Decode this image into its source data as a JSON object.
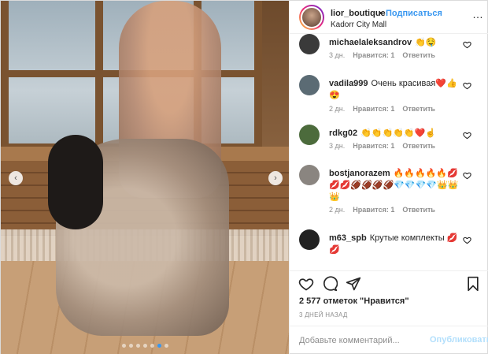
{
  "photo": {
    "slide_count": 7,
    "active_slide_index": 5,
    "nav_prev_glyph": "‹",
    "nav_next_glyph": "›"
  },
  "header": {
    "username": "lior_boutique",
    "separator": "•",
    "follow_label": "Подписаться",
    "location": "Kadorr City Mall",
    "more_glyph": "…"
  },
  "comments": [
    {
      "user": "michaelaleksandrov",
      "text": "👏🤤",
      "time": "3 дн.",
      "likes": "Нравится: 1",
      "reply": "Ответить",
      "avatar_color": "#3a3a3a"
    },
    {
      "user": "vadila999",
      "text": "Очень красивая❤️👍😍",
      "time": "2 дн.",
      "likes": "Нравится: 1",
      "reply": "Ответить",
      "avatar_color": "#5b6b74"
    },
    {
      "user": "rdkg02",
      "text": "👏👏👏👏👏❤️☝️",
      "time": "3 дн.",
      "likes": "Нравится: 1",
      "reply": "Ответить",
      "avatar_color": "#4c6b3c"
    },
    {
      "user": "bostjanorazem",
      "text": "🔥🔥🔥🔥🔥💋💋💋🏈🏈🏈🏈💎💎💎💎👑👑👑",
      "time": "2 дн.",
      "likes": "Нравится: 1",
      "reply": "Ответить",
      "avatar_color": "#8a8580"
    },
    {
      "user": "m63_spb",
      "text": "Крутые комплекты 💋💋",
      "time": "",
      "likes": "",
      "reply": "",
      "avatar_color": "#222222"
    }
  ],
  "likes_text": "2 577 отметок \"Нравится\"",
  "date_text": "3 ДНЕЙ НАЗАД",
  "add_comment": {
    "placeholder": "Добавьте комментарий...",
    "publish_label": "Опубликовать"
  },
  "colors": {
    "accent": "#3897f0",
    "publish_disabled": "#b2dffc",
    "muted": "#8e8e8e"
  },
  "icons": [
    "heart-icon",
    "comment-icon",
    "share-icon",
    "bookmark-icon",
    "more-icon"
  ]
}
